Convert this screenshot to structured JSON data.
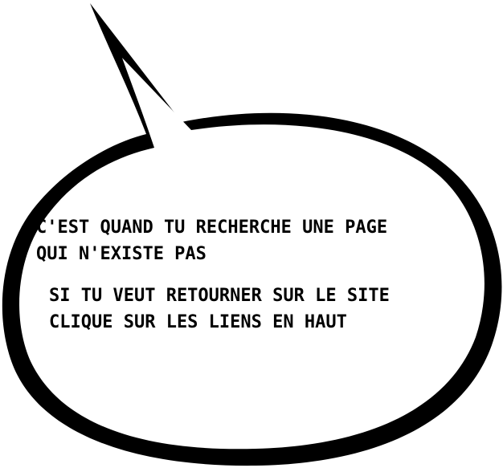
{
  "message": {
    "line1": "C'EST QUAND TU RECHERCHE UNE PAGE",
    "line2": "QUI N'EXISTE PAS",
    "line3": "SI TU VEUT RETOURNER SUR LE SITE",
    "line4": "CLIQUE SUR LES LIENS EN HAUT"
  },
  "colors": {
    "outline": "#000000",
    "fill": "#ffffff",
    "text": "#000000"
  },
  "icon": "speech-bubble-icon"
}
